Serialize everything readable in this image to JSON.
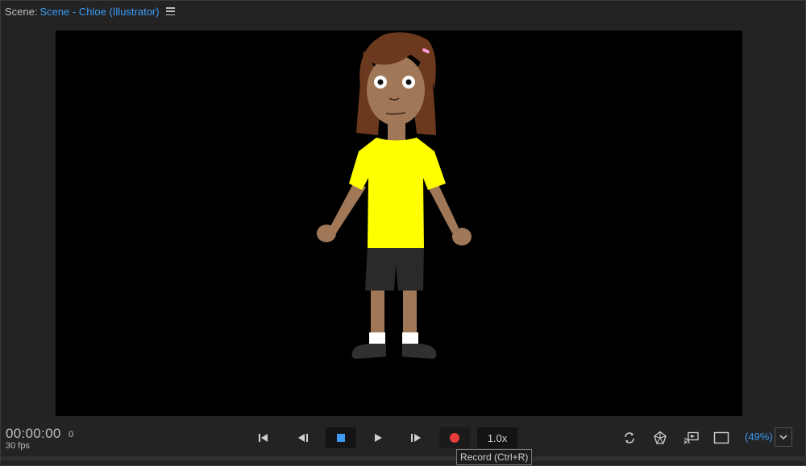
{
  "header": {
    "prefix": "Scene:",
    "scene_name": "Scene - Chloe (Illustrator)",
    "menu_icon": "hamburger-menu-icon"
  },
  "stage": {
    "background": "#000000",
    "character": {
      "hair": "#6b3a1e",
      "skin": "#a07858",
      "shirt": "#ffff00",
      "shorts": "#2a2a2a",
      "socks": "#ffffff",
      "shoes": "#303030",
      "hair_clip": "#ff9ad5"
    }
  },
  "transport": {
    "timecode": "00:00:00",
    "frame": "0",
    "fps": "30 fps",
    "buttons": [
      {
        "icon": "go-to-start-icon"
      },
      {
        "icon": "step-back-icon"
      },
      {
        "icon": "stop-icon"
      },
      {
        "icon": "play-icon"
      },
      {
        "icon": "step-forward-icon"
      },
      {
        "icon": "record-icon"
      }
    ],
    "speed": "1.0x",
    "record_color": "#e83b3b",
    "stop_color": "#3b9bf5"
  },
  "view_tools": {
    "icons": [
      "refresh-icon",
      "wireframe-icon",
      "cast-icon",
      "frame-icon"
    ],
    "zoom": "(49%)",
    "dropdown_icon": "chevron-down-icon"
  },
  "tooltip": {
    "text": "Record (Ctrl+R)"
  }
}
